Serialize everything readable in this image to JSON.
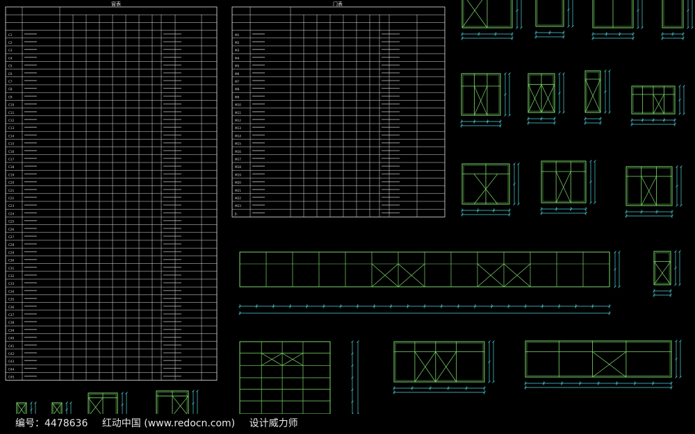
{
  "colors": {
    "background": "#000000",
    "table_line": "#e6e6e6",
    "table_text": "#d8d8d8",
    "window_frame": "#7ddc6a",
    "dimension": "#4fd6e0",
    "watermark_text": "#e8e8e8"
  },
  "watermark": {
    "id_label": "编号：",
    "id_value": "4478636",
    "site": "红动中国 (www.redocn.com)",
    "author": "设计威力师"
  },
  "window_table": {
    "title": "窗表",
    "row_codes": [
      "C1",
      "C2",
      "C3",
      "C4",
      "C5",
      "C6",
      "C7",
      "C8",
      "C9",
      "C10",
      "C11",
      "C12",
      "C13",
      "C14",
      "C15",
      "C16",
      "C17",
      "C18",
      "C19",
      "C20",
      "C21",
      "C22",
      "C23",
      "C24",
      "C25",
      "C26",
      "C27",
      "C28",
      "C29",
      "C30",
      "C31",
      "C32",
      "C33",
      "C34",
      "C35",
      "C36",
      "C37",
      "C38",
      "C39",
      "C40",
      "C41",
      "C42",
      "C43",
      "C44",
      "C45"
    ]
  },
  "door_table": {
    "title": "门表",
    "row_codes": [
      "M1",
      "M2",
      "M3",
      "M4",
      "M5",
      "M6",
      "M7",
      "M8",
      "M9",
      "M10",
      "M11",
      "M12",
      "M13",
      "M14",
      "M15",
      "M16",
      "M17",
      "M18",
      "M19",
      "M20",
      "M21",
      "M22",
      "M23",
      "JL"
    ]
  }
}
